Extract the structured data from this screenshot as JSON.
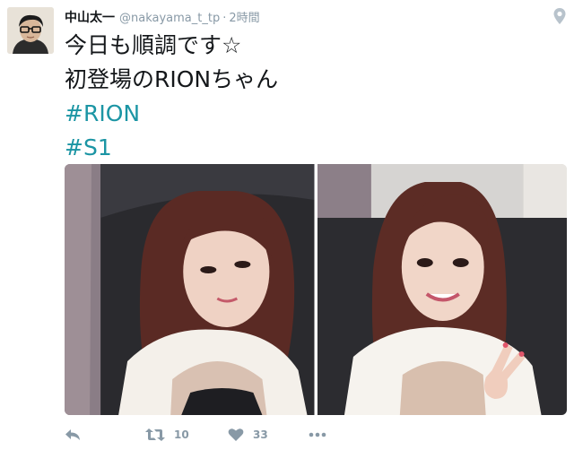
{
  "user": {
    "name": "中山太一",
    "handle": "@nakayama_t_tp",
    "separator": "·",
    "time": "2時間"
  },
  "tweet": {
    "lines": [
      "今日も順調です☆",
      "初登場のRIONちゃん"
    ],
    "hashtags": [
      "#RION",
      "#S1"
    ]
  },
  "media": {
    "photo_count": 2
  },
  "actions": {
    "reply_icon": "reply-icon",
    "retweet_count": "10",
    "like_count": "33",
    "more_icon": "more-icon"
  },
  "colors": {
    "text": "#14171a",
    "meta": "#8899a6",
    "hashtag": "#1b95a4",
    "icon": "#8899a6"
  }
}
